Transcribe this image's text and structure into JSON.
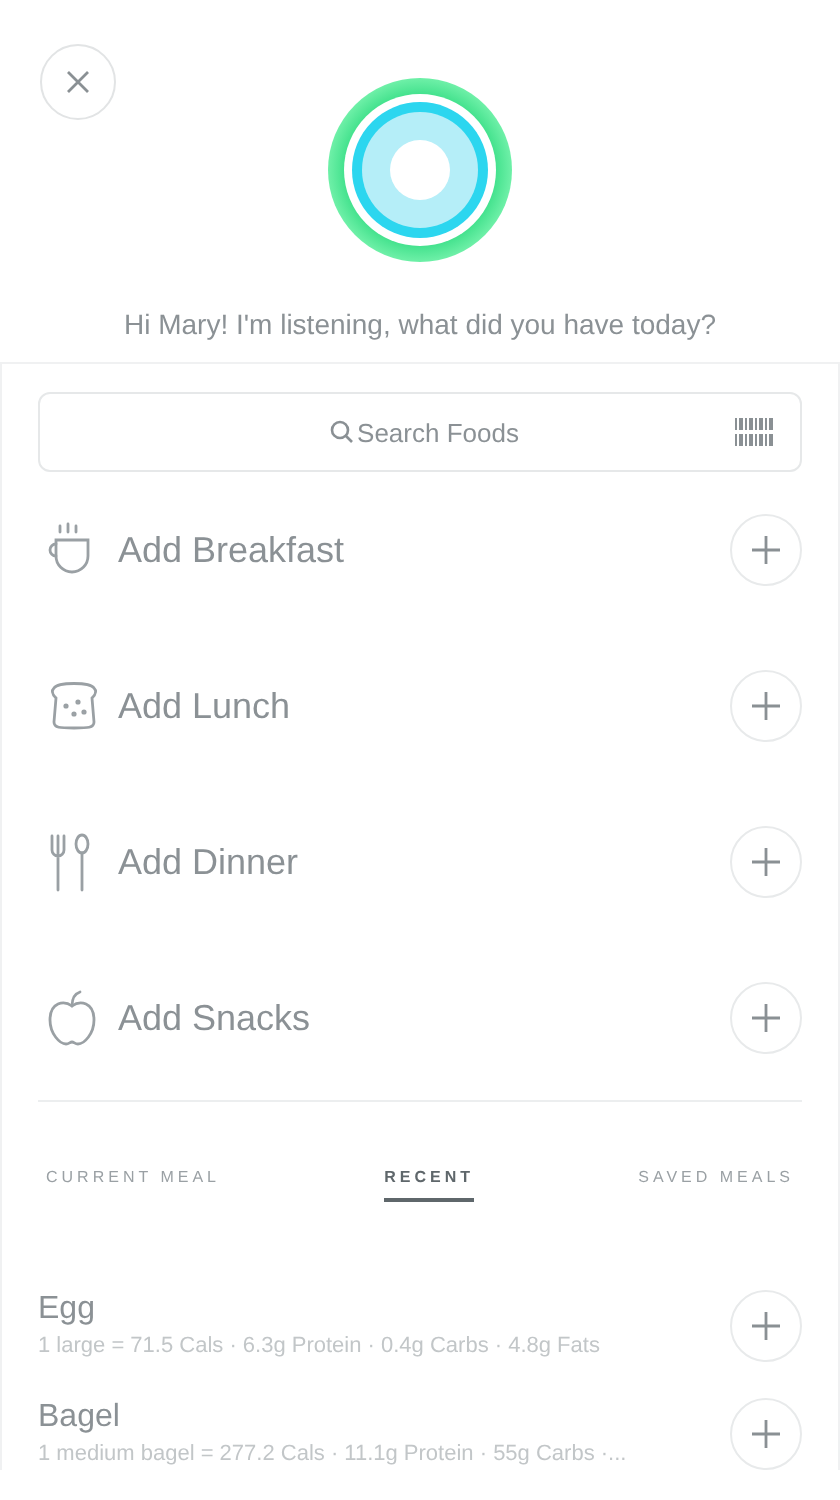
{
  "greeting": "Hi Mary! I'm listening, what did you have today?",
  "search": {
    "placeholder": "Search Foods"
  },
  "meals": [
    {
      "kind": "breakfast",
      "label": "Add Breakfast"
    },
    {
      "kind": "lunch",
      "label": "Add Lunch"
    },
    {
      "kind": "dinner",
      "label": "Add Dinner"
    },
    {
      "kind": "snacks",
      "label": "Add Snacks"
    }
  ],
  "tabs": [
    {
      "label": "CURRENT MEAL",
      "selected": false
    },
    {
      "label": "RECENT",
      "selected": true
    },
    {
      "label": "SAVED MEALS",
      "selected": false
    }
  ],
  "foods": [
    {
      "name": "Egg",
      "details": "1 large = 71.5 Cals · 6.3g Protein · 0.4g Carbs · 4.8g Fats"
    },
    {
      "name": "Bagel",
      "details": "1 medium bagel = 277.2 Cals · 11.1g Protein · 55g Carbs ·..."
    }
  ]
}
